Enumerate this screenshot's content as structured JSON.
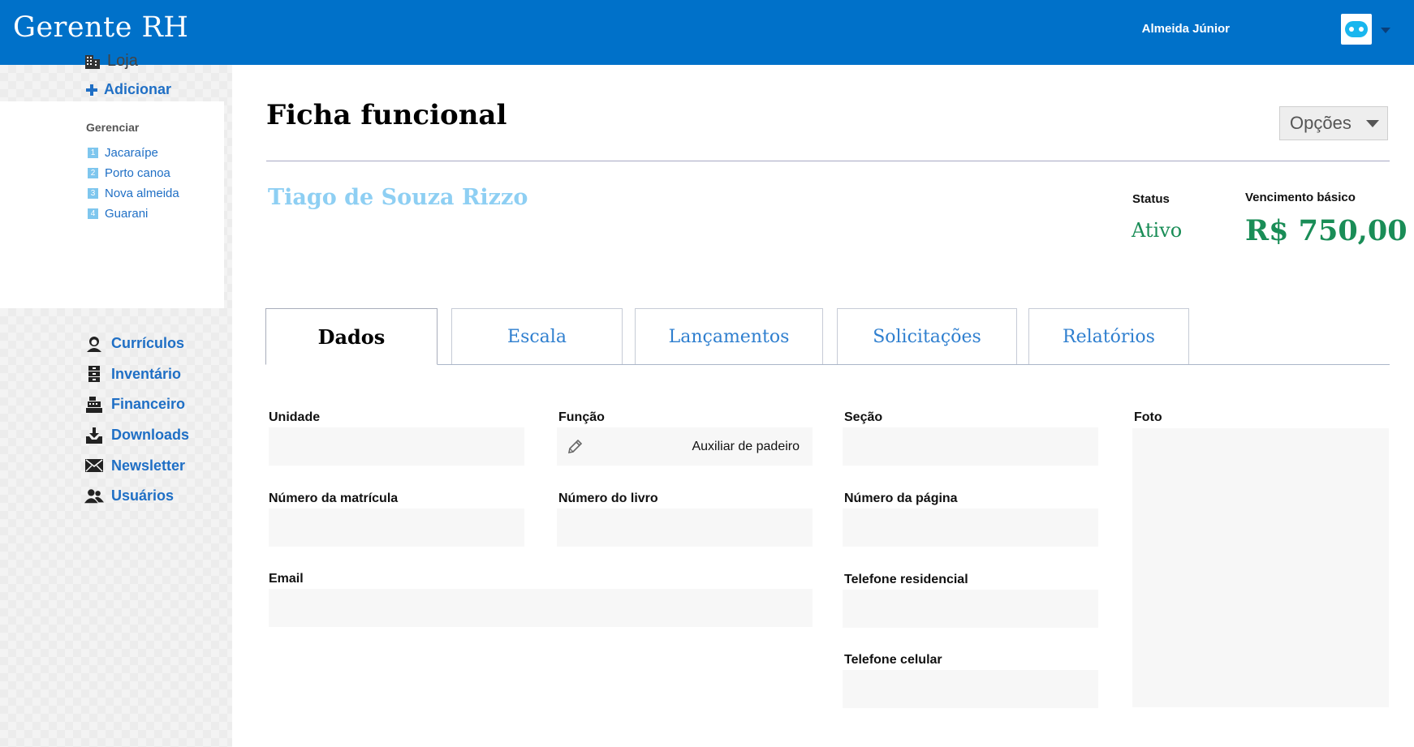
{
  "app": {
    "title": "Gerente RH"
  },
  "user": {
    "name": "Almeida Júnior",
    "avatar_icon": "robot-avatar-icon"
  },
  "sidebar": {
    "store_title": "Loja",
    "store_icon": "building-icon",
    "add_label": "Adicionar",
    "manage_label": "Gerenciar",
    "stores": [
      {
        "num": "1",
        "label": "Jacaraípe"
      },
      {
        "num": "2",
        "label": "Porto canoa"
      },
      {
        "num": "3",
        "label": "Nova almeida"
      },
      {
        "num": "4",
        "label": "Guarani"
      }
    ],
    "nav": [
      {
        "label": "Currículos",
        "icon": "person-icon"
      },
      {
        "label": "Inventário",
        "icon": "cabinet-icon"
      },
      {
        "label": "Financeiro",
        "icon": "cash-register-icon"
      },
      {
        "label": "Downloads",
        "icon": "download-tray-icon"
      },
      {
        "label": "Newsletter",
        "icon": "envelope-icon"
      },
      {
        "label": "Usuários",
        "icon": "users-icon"
      }
    ]
  },
  "page": {
    "title": "Ficha funcional",
    "options_label": "Opções",
    "employee_name": "Tiago de Souza Rizzo",
    "status_label": "Status",
    "status_value": "Ativo",
    "salary_label": "Vencimento básico",
    "salary_value": "R$ 750,00",
    "colors": {
      "accent": "#0071c9",
      "positive": "#1a8d57",
      "name": "#8ecff3"
    }
  },
  "tabs": [
    {
      "label": "Dados",
      "active": true
    },
    {
      "label": "Escala"
    },
    {
      "label": "Lançamentos"
    },
    {
      "label": "Solicitações"
    },
    {
      "label": "Relatórios"
    }
  ],
  "form": {
    "unidade": {
      "label": "Unidade",
      "value": ""
    },
    "funcao": {
      "label": "Função",
      "value": "Auxiliar de padeiro",
      "icon": "pencil-icon"
    },
    "secao": {
      "label": "Seção",
      "value": ""
    },
    "foto": {
      "label": "Foto"
    },
    "matricula": {
      "label": "Número da matrícula",
      "value": ""
    },
    "livro": {
      "label": "Número do livro",
      "value": ""
    },
    "pagina": {
      "label": "Número da página",
      "value": ""
    },
    "email": {
      "label": "Email",
      "value": ""
    },
    "tel_residencial": {
      "label": "Telefone residencial",
      "value": ""
    },
    "tel_celular": {
      "label": "Telefone celular",
      "value": ""
    }
  }
}
